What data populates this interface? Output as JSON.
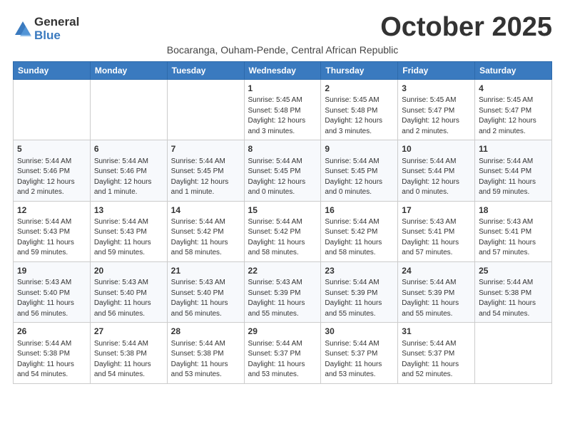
{
  "header": {
    "logo_general": "General",
    "logo_blue": "Blue",
    "month_title": "October 2025",
    "subtitle": "Bocaranga, Ouham-Pende, Central African Republic"
  },
  "weekdays": [
    "Sunday",
    "Monday",
    "Tuesday",
    "Wednesday",
    "Thursday",
    "Friday",
    "Saturday"
  ],
  "weeks": [
    [
      {
        "day": "",
        "info": ""
      },
      {
        "day": "",
        "info": ""
      },
      {
        "day": "",
        "info": ""
      },
      {
        "day": "1",
        "info": "Sunrise: 5:45 AM\nSunset: 5:48 PM\nDaylight: 12 hours and 3 minutes."
      },
      {
        "day": "2",
        "info": "Sunrise: 5:45 AM\nSunset: 5:48 PM\nDaylight: 12 hours and 3 minutes."
      },
      {
        "day": "3",
        "info": "Sunrise: 5:45 AM\nSunset: 5:47 PM\nDaylight: 12 hours and 2 minutes."
      },
      {
        "day": "4",
        "info": "Sunrise: 5:45 AM\nSunset: 5:47 PM\nDaylight: 12 hours and 2 minutes."
      }
    ],
    [
      {
        "day": "5",
        "info": "Sunrise: 5:44 AM\nSunset: 5:46 PM\nDaylight: 12 hours and 2 minutes."
      },
      {
        "day": "6",
        "info": "Sunrise: 5:44 AM\nSunset: 5:46 PM\nDaylight: 12 hours and 1 minute."
      },
      {
        "day": "7",
        "info": "Sunrise: 5:44 AM\nSunset: 5:45 PM\nDaylight: 12 hours and 1 minute."
      },
      {
        "day": "8",
        "info": "Sunrise: 5:44 AM\nSunset: 5:45 PM\nDaylight: 12 hours and 0 minutes."
      },
      {
        "day": "9",
        "info": "Sunrise: 5:44 AM\nSunset: 5:45 PM\nDaylight: 12 hours and 0 minutes."
      },
      {
        "day": "10",
        "info": "Sunrise: 5:44 AM\nSunset: 5:44 PM\nDaylight: 12 hours and 0 minutes."
      },
      {
        "day": "11",
        "info": "Sunrise: 5:44 AM\nSunset: 5:44 PM\nDaylight: 11 hours and 59 minutes."
      }
    ],
    [
      {
        "day": "12",
        "info": "Sunrise: 5:44 AM\nSunset: 5:43 PM\nDaylight: 11 hours and 59 minutes."
      },
      {
        "day": "13",
        "info": "Sunrise: 5:44 AM\nSunset: 5:43 PM\nDaylight: 11 hours and 59 minutes."
      },
      {
        "day": "14",
        "info": "Sunrise: 5:44 AM\nSunset: 5:42 PM\nDaylight: 11 hours and 58 minutes."
      },
      {
        "day": "15",
        "info": "Sunrise: 5:44 AM\nSunset: 5:42 PM\nDaylight: 11 hours and 58 minutes."
      },
      {
        "day": "16",
        "info": "Sunrise: 5:44 AM\nSunset: 5:42 PM\nDaylight: 11 hours and 58 minutes."
      },
      {
        "day": "17",
        "info": "Sunrise: 5:43 AM\nSunset: 5:41 PM\nDaylight: 11 hours and 57 minutes."
      },
      {
        "day": "18",
        "info": "Sunrise: 5:43 AM\nSunset: 5:41 PM\nDaylight: 11 hours and 57 minutes."
      }
    ],
    [
      {
        "day": "19",
        "info": "Sunrise: 5:43 AM\nSunset: 5:40 PM\nDaylight: 11 hours and 56 minutes."
      },
      {
        "day": "20",
        "info": "Sunrise: 5:43 AM\nSunset: 5:40 PM\nDaylight: 11 hours and 56 minutes."
      },
      {
        "day": "21",
        "info": "Sunrise: 5:43 AM\nSunset: 5:40 PM\nDaylight: 11 hours and 56 minutes."
      },
      {
        "day": "22",
        "info": "Sunrise: 5:43 AM\nSunset: 5:39 PM\nDaylight: 11 hours and 55 minutes."
      },
      {
        "day": "23",
        "info": "Sunrise: 5:44 AM\nSunset: 5:39 PM\nDaylight: 11 hours and 55 minutes."
      },
      {
        "day": "24",
        "info": "Sunrise: 5:44 AM\nSunset: 5:39 PM\nDaylight: 11 hours and 55 minutes."
      },
      {
        "day": "25",
        "info": "Sunrise: 5:44 AM\nSunset: 5:38 PM\nDaylight: 11 hours and 54 minutes."
      }
    ],
    [
      {
        "day": "26",
        "info": "Sunrise: 5:44 AM\nSunset: 5:38 PM\nDaylight: 11 hours and 54 minutes."
      },
      {
        "day": "27",
        "info": "Sunrise: 5:44 AM\nSunset: 5:38 PM\nDaylight: 11 hours and 54 minutes."
      },
      {
        "day": "28",
        "info": "Sunrise: 5:44 AM\nSunset: 5:38 PM\nDaylight: 11 hours and 53 minutes."
      },
      {
        "day": "29",
        "info": "Sunrise: 5:44 AM\nSunset: 5:37 PM\nDaylight: 11 hours and 53 minutes."
      },
      {
        "day": "30",
        "info": "Sunrise: 5:44 AM\nSunset: 5:37 PM\nDaylight: 11 hours and 53 minutes."
      },
      {
        "day": "31",
        "info": "Sunrise: 5:44 AM\nSunset: 5:37 PM\nDaylight: 11 hours and 52 minutes."
      },
      {
        "day": "",
        "info": ""
      }
    ]
  ]
}
